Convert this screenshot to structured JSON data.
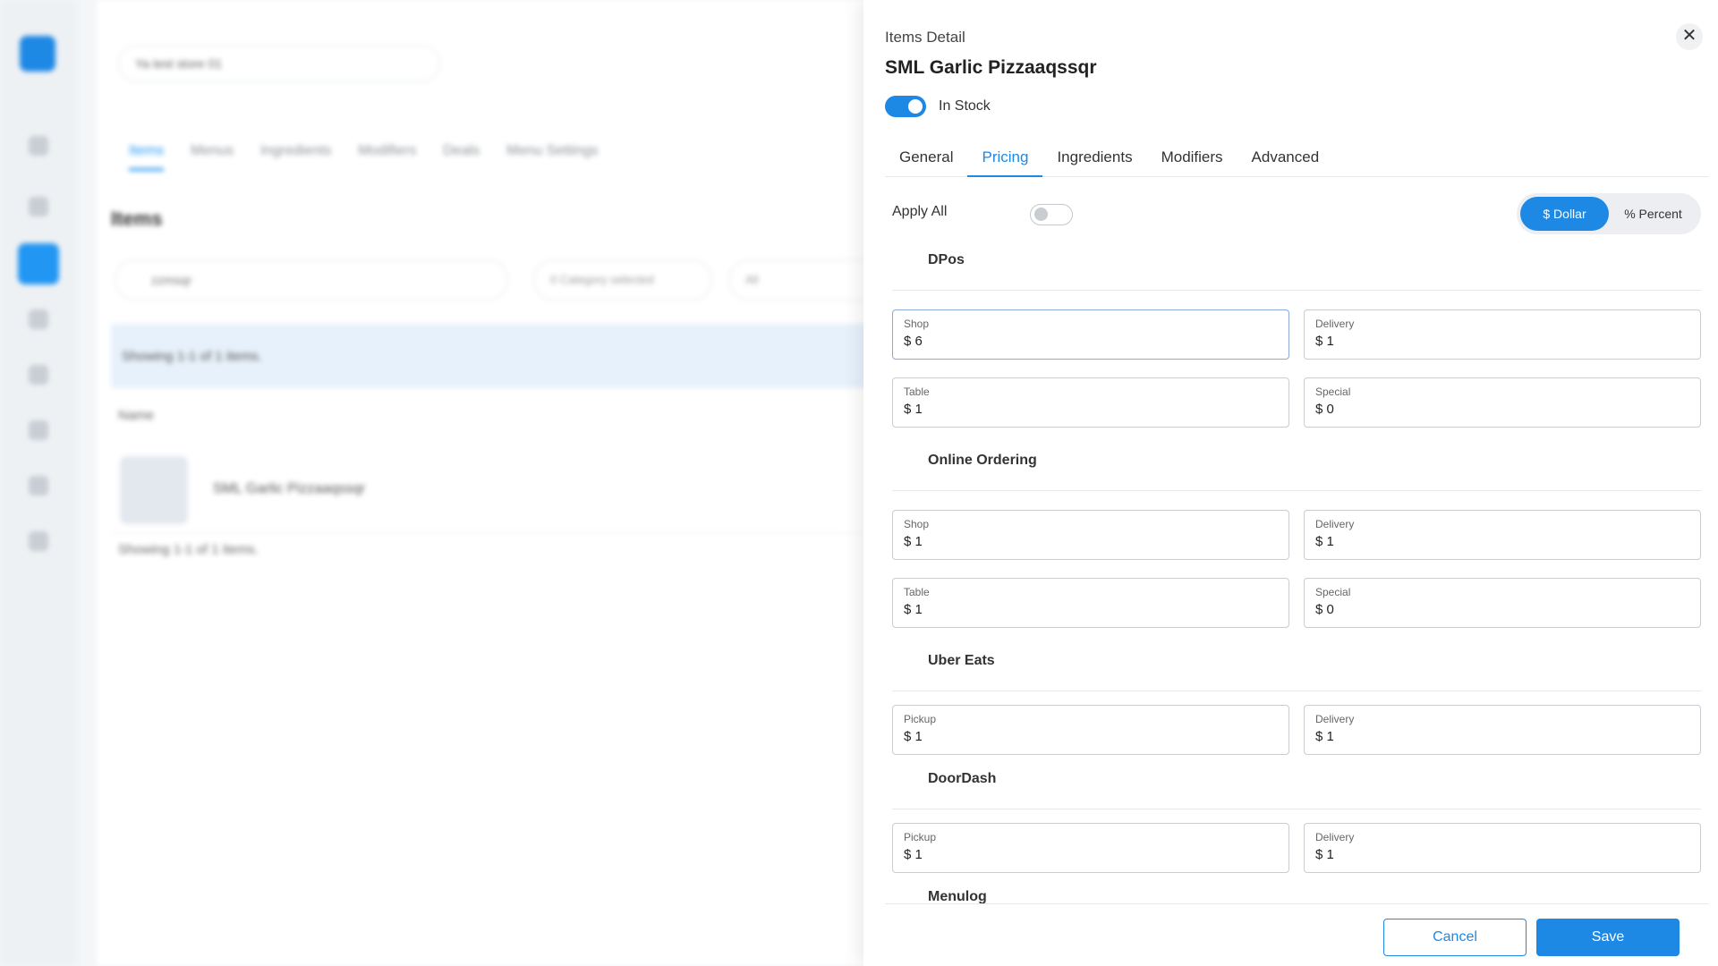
{
  "background": {
    "store_select": "Ya test store 01",
    "tabs": [
      "Items",
      "Menus",
      "Ingredients",
      "Modifiers",
      "Deals",
      "Menu Settings"
    ],
    "heading": "Items",
    "search_value": "zzmsqr",
    "category_filter": "0 Category selected",
    "all_filter": "All",
    "showing_text": "Showing 1-1 of 1 items.",
    "column_name": "Name",
    "row_name": "SML Garlic Pizzaaqssqr",
    "footer_text": "Showing 1-1 of 1 items."
  },
  "drawer": {
    "caption": "Items Detail",
    "title": "SML Garlic Pizzaaqssqr",
    "stock_label": "In Stock",
    "close_symbol": "✕",
    "tabs": [
      "General",
      "Pricing",
      "Ingredients",
      "Modifiers",
      "Advanced"
    ],
    "active_tab": "Pricing",
    "apply_all_label": "Apply All",
    "dollar_label": "$ Dollar",
    "percent_label": "% Percent",
    "sections": {
      "dpos": {
        "title": "DPos",
        "fields": [
          {
            "label": "Shop",
            "value": "$ 6"
          },
          {
            "label": "Delivery",
            "value": "$ 1"
          },
          {
            "label": "Table",
            "value": "$ 1"
          },
          {
            "label": "Special",
            "value": "$ 0"
          }
        ]
      },
      "online": {
        "title": "Online Ordering",
        "fields": [
          {
            "label": "Shop",
            "value": "$ 1"
          },
          {
            "label": "Delivery",
            "value": "$ 1"
          },
          {
            "label": "Table",
            "value": "$ 1"
          },
          {
            "label": "Special",
            "value": "$ 0"
          }
        ]
      },
      "ubereats": {
        "title": "Uber Eats",
        "fields": [
          {
            "label": "Pickup",
            "value": "$ 1"
          },
          {
            "label": "Delivery",
            "value": "$ 1"
          }
        ]
      },
      "doordash": {
        "title": "DoorDash",
        "fields": [
          {
            "label": "Pickup",
            "value": "$ 1"
          },
          {
            "label": "Delivery",
            "value": "$ 1"
          }
        ]
      },
      "menulog": {
        "title": "Menulog"
      }
    },
    "cancel_label": "Cancel",
    "save_label": "Save"
  },
  "colors": {
    "accent": "#1e88e5"
  }
}
